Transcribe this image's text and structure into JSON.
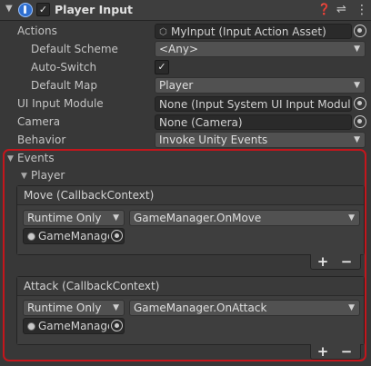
{
  "header": {
    "title": "Player Input",
    "enabled": "✓",
    "icons": [
      "help-icon",
      "preset-icon",
      "kebab-icon"
    ]
  },
  "properties": {
    "actions": {
      "label": "Actions",
      "value": "MyInput (Input Action Asset)"
    },
    "default_scheme": {
      "label": "Default Scheme",
      "value": "<Any>"
    },
    "auto_switch": {
      "label": "Auto-Switch",
      "checked": "✓"
    },
    "default_map": {
      "label": "Default Map",
      "value": "Player"
    },
    "ui_input_module": {
      "label": "UI Input Module",
      "value": "None (Input System UI Input Module)"
    },
    "camera": {
      "label": "Camera",
      "value": "None (Camera)"
    },
    "behavior": {
      "label": "Behavior",
      "value": "Invoke Unity Events"
    }
  },
  "events": {
    "label": "Events",
    "map_label": "Player",
    "callbacks": [
      {
        "title": "Move (CallbackContext)",
        "runtime": "Runtime Only",
        "function": "GameManager.OnMove",
        "object": "GameManager",
        "add": "+",
        "remove": "−"
      },
      {
        "title": "Attack (CallbackContext)",
        "runtime": "Runtime Only",
        "function": "GameManager.OnAttack",
        "object": "GameManager",
        "add": "+",
        "remove": "−"
      }
    ]
  },
  "colors": {
    "highlight": "#c4161c",
    "background": "#383838"
  }
}
